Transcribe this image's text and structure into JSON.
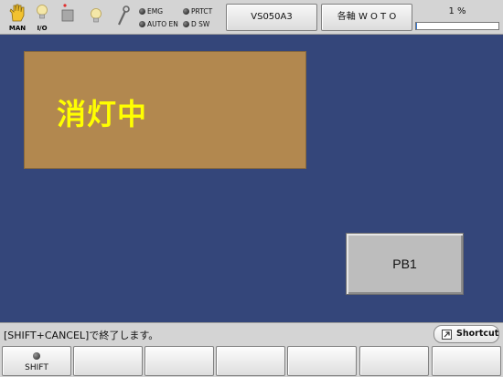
{
  "status_bar": {
    "mode_icons": [
      {
        "icon": "hand-icon",
        "caption": "MAN"
      },
      {
        "icon": "lightbulb-icon",
        "caption": "I/O"
      },
      {
        "icon": "stop-block-icon",
        "caption": ""
      },
      {
        "icon": "lightbulb-icon",
        "caption": ""
      },
      {
        "icon": "wrench-icon",
        "caption": ""
      }
    ],
    "indicators": [
      {
        "label": "EMG"
      },
      {
        "label": "PRTCT"
      },
      {
        "label": "AUTO EN"
      },
      {
        "label": "D SW"
      }
    ],
    "robot_label": "VS050A3",
    "axis_label": "各軸  W O T O",
    "speed_text": "1 %",
    "speed_fraction": 0.01
  },
  "lamp": {
    "text": "消灯中",
    "bg_color": "#b2884f",
    "text_color": "#ffff00"
  },
  "pb1": {
    "label": "PB1"
  },
  "message_bar": {
    "message": "[SHIFT+CANCEL]で終了します。",
    "shortcut_label": "Shortcut"
  },
  "function_keys": [
    {
      "label": "SHIFT",
      "has_led": true
    },
    {
      "label": "",
      "has_led": false
    },
    {
      "label": "",
      "has_led": false
    },
    {
      "label": "",
      "has_led": false
    },
    {
      "label": "",
      "has_led": false
    },
    {
      "label": "",
      "has_led": false
    },
    {
      "label": "",
      "has_led": false
    }
  ],
  "colors": {
    "background": "#34467a",
    "panel_gray": "#d4d4d4",
    "accent_blue": "#3a7bd5"
  }
}
